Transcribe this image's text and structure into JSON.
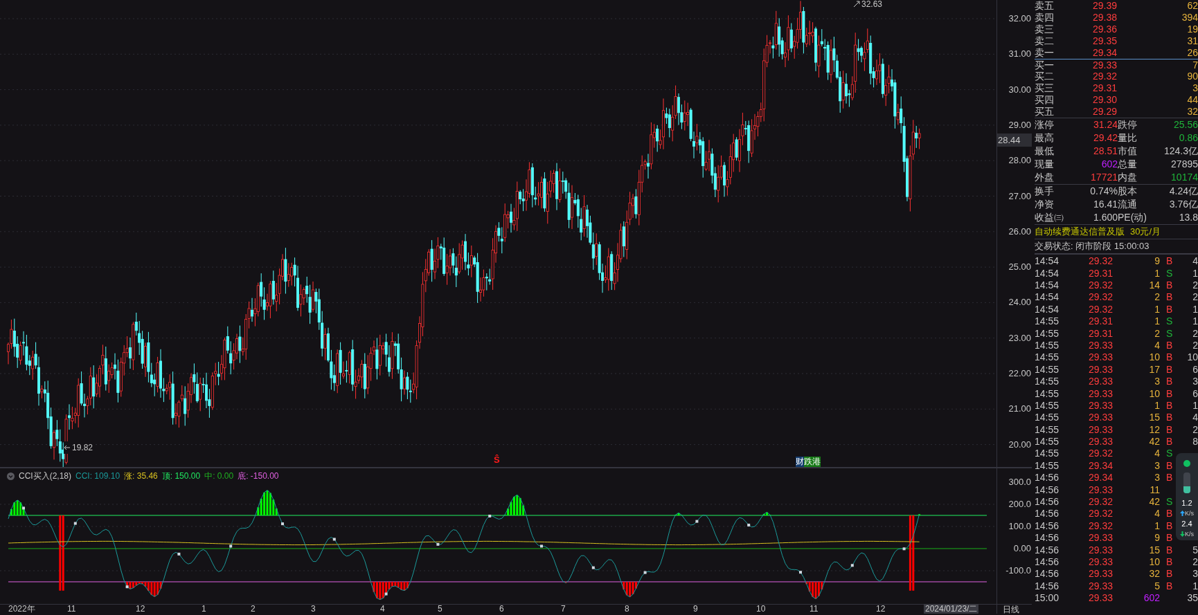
{
  "price_chart": {
    "high_label": "32.63",
    "low_label": "19.82",
    "current_price": "28.44",
    "y_axis": [
      "32.00",
      "31.00",
      "30.00",
      "29.00",
      "28.00",
      "27.00",
      "26.00",
      "25.00",
      "24.00",
      "23.00",
      "22.00",
      "21.00",
      "20.00"
    ],
    "markers": [
      {
        "text": "Ŝ",
        "color": "#ff1a1a"
      }
    ],
    "tags": [
      {
        "text": "财",
        "color": "#123a6e"
      },
      {
        "text": "跌港",
        "color": "#167a16"
      }
    ]
  },
  "indicator": {
    "name": "CCI买入(2,18)",
    "values": [
      {
        "label": "CCI:",
        "value": "109.10",
        "color": "#1a9a9a"
      },
      {
        "label": "涨:",
        "value": "35.46",
        "color": "#d8c020"
      },
      {
        "label": "顶:",
        "value": "150.00",
        "color": "#20e860"
      },
      {
        "label": "中:",
        "value": "0.00",
        "color": "#1fb020"
      },
      {
        "label": "底:",
        "value": "-150.00",
        "color": "#e060e0"
      }
    ],
    "y_axis": [
      "300.0",
      "200.0",
      "100.0",
      "0.00",
      "-100.0"
    ]
  },
  "x_axis": {
    "labels": [
      "2022年",
      "11",
      "12",
      "1",
      "2",
      "3",
      "4",
      "5",
      "6",
      "7",
      "8",
      "9",
      "10",
      "11",
      "12"
    ],
    "cursor_date": "2024/01/23/二",
    "period": "日线"
  },
  "order_book": {
    "asks": [
      {
        "label": "卖五",
        "price": "29.39",
        "volume": "62"
      },
      {
        "label": "卖四",
        "price": "29.38",
        "volume": "394"
      },
      {
        "label": "卖三",
        "price": "29.36",
        "volume": "19"
      },
      {
        "label": "卖二",
        "price": "29.35",
        "volume": "31"
      },
      {
        "label": "卖一",
        "price": "29.34",
        "volume": "26"
      }
    ],
    "bids": [
      {
        "label": "买一",
        "price": "29.33",
        "volume": "7"
      },
      {
        "label": "买二",
        "price": "29.32",
        "volume": "90"
      },
      {
        "label": "买三",
        "price": "29.31",
        "volume": "3"
      },
      {
        "label": "买四",
        "price": "29.30",
        "volume": "44"
      },
      {
        "label": "买五",
        "price": "29.29",
        "volume": "32"
      }
    ]
  },
  "quote_stats": [
    [
      {
        "label": "涨停",
        "value": "31.24",
        "color": "#ff3d3d"
      },
      {
        "label": "跌停",
        "value": "25.56",
        "color": "#1fb53a"
      }
    ],
    [
      {
        "label": "最高",
        "value": "29.42",
        "color": "#ff3d3d"
      },
      {
        "label": "量比",
        "value": "0.86",
        "color": "#1fb53a"
      }
    ],
    [
      {
        "label": "最低",
        "value": "28.51",
        "color": "#ff3d3d"
      },
      {
        "label": "市值",
        "value": "124.3亿",
        "color": "#c8c8c8"
      }
    ],
    [
      {
        "label": "现量",
        "value": "602",
        "color": "#c020ff"
      },
      {
        "label": "总量",
        "value": "27895",
        "color": "#c8c8c8"
      }
    ],
    [
      {
        "label": "外盘",
        "value": "17721",
        "color": "#ff3d3d"
      },
      {
        "label": "内盘",
        "value": "10174",
        "color": "#1fb53a"
      }
    ]
  ],
  "finance_stats": [
    [
      {
        "label": "换手",
        "value": "0.74%"
      },
      {
        "label": "股本",
        "value": "4.24亿"
      }
    ],
    [
      {
        "label": "净资",
        "value": "16.41"
      },
      {
        "label": "流通",
        "value": "3.76亿"
      }
    ],
    [
      {
        "label": "收益㈢",
        "value": "1.600"
      },
      {
        "label": "PE(动)",
        "value": "13.8"
      }
    ]
  ],
  "promo": {
    "text": "自动续费通达信普及版",
    "price": "30元/月"
  },
  "status": "交易状态: 闭市阶段 15:00:03",
  "trades": [
    {
      "time": "14:54",
      "price": "29.32",
      "volume": "9",
      "side": "B",
      "color": "#ff3d3d",
      "count": "4"
    },
    {
      "time": "14:54",
      "price": "29.31",
      "volume": "1",
      "side": "S",
      "color": "#1fb53a",
      "count": "1"
    },
    {
      "time": "14:54",
      "price": "29.32",
      "volume": "14",
      "side": "B",
      "color": "#ff3d3d",
      "count": "2"
    },
    {
      "time": "14:54",
      "price": "29.32",
      "volume": "2",
      "side": "B",
      "color": "#ff3d3d",
      "count": "2"
    },
    {
      "time": "14:54",
      "price": "29.32",
      "volume": "1",
      "side": "B",
      "color": "#ff3d3d",
      "count": "1"
    },
    {
      "time": "14:55",
      "price": "29.31",
      "volume": "1",
      "side": "S",
      "color": "#1fb53a",
      "count": "1"
    },
    {
      "time": "14:55",
      "price": "29.31",
      "volume": "2",
      "side": "S",
      "color": "#1fb53a",
      "count": "2"
    },
    {
      "time": "14:55",
      "price": "29.33",
      "volume": "4",
      "side": "B",
      "color": "#ff3d3d",
      "count": "2"
    },
    {
      "time": "14:55",
      "price": "29.33",
      "volume": "10",
      "side": "B",
      "color": "#ff3d3d",
      "count": "10"
    },
    {
      "time": "14:55",
      "price": "29.33",
      "volume": "17",
      "side": "B",
      "color": "#ff3d3d",
      "count": "6"
    },
    {
      "time": "14:55",
      "price": "29.33",
      "volume": "3",
      "side": "B",
      "color": "#ff3d3d",
      "count": "3"
    },
    {
      "time": "14:55",
      "price": "29.33",
      "volume": "10",
      "side": "B",
      "color": "#ff3d3d",
      "count": "6"
    },
    {
      "time": "14:55",
      "price": "29.33",
      "volume": "1",
      "side": "B",
      "color": "#ff3d3d",
      "count": "1"
    },
    {
      "time": "14:55",
      "price": "29.33",
      "volume": "15",
      "side": "B",
      "color": "#ff3d3d",
      "count": "4"
    },
    {
      "time": "14:55",
      "price": "29.33",
      "volume": "12",
      "side": "B",
      "color": "#ff3d3d",
      "count": "2"
    },
    {
      "time": "14:55",
      "price": "29.33",
      "volume": "42",
      "side": "B",
      "color": "#ff3d3d",
      "count": "8"
    },
    {
      "time": "14:55",
      "price": "29.32",
      "volume": "4",
      "side": "S",
      "color": "#1fb53a"
    },
    {
      "time": "14:55",
      "price": "29.34",
      "volume": "3",
      "side": "B",
      "color": "#ff3d3d"
    },
    {
      "time": "14:56",
      "price": "29.34",
      "volume": "3",
      "side": "B",
      "color": "#ff3d3d"
    },
    {
      "time": "14:56",
      "price": "29.33",
      "volume": "11"
    },
    {
      "time": "14:56",
      "price": "29.32",
      "volume": "42",
      "side": "S",
      "color": "#1fb53a"
    },
    {
      "time": "14:56",
      "price": "29.32",
      "volume": "4",
      "side": "B",
      "color": "#ff3d3d"
    },
    {
      "time": "14:56",
      "price": "29.32",
      "volume": "1",
      "side": "B",
      "color": "#ff3d3d"
    },
    {
      "time": "14:56",
      "price": "29.33",
      "volume": "9",
      "side": "B",
      "color": "#ff3d3d"
    },
    {
      "time": "14:56",
      "price": "29.33",
      "volume": "15",
      "side": "B",
      "color": "#ff3d3d",
      "count": "5"
    },
    {
      "time": "14:56",
      "price": "29.33",
      "volume": "10",
      "side": "B",
      "color": "#ff3d3d",
      "count": "2"
    },
    {
      "time": "14:56",
      "price": "29.33",
      "volume": "32",
      "side": "B",
      "color": "#ff3d3d",
      "count": "3"
    },
    {
      "time": "14:56",
      "price": "29.33",
      "volume": "5",
      "side": "B",
      "color": "#ff3d3d",
      "count": "1"
    },
    {
      "time": "15:00",
      "price": "29.33",
      "volume": "602",
      "count": "35",
      "current": true
    }
  ],
  "speed_widget": {
    "online": true,
    "level": 0.35,
    "upload": "1.2",
    "upload_unit": "K/s",
    "download": "2.4",
    "download_unit": "K/s"
  }
}
